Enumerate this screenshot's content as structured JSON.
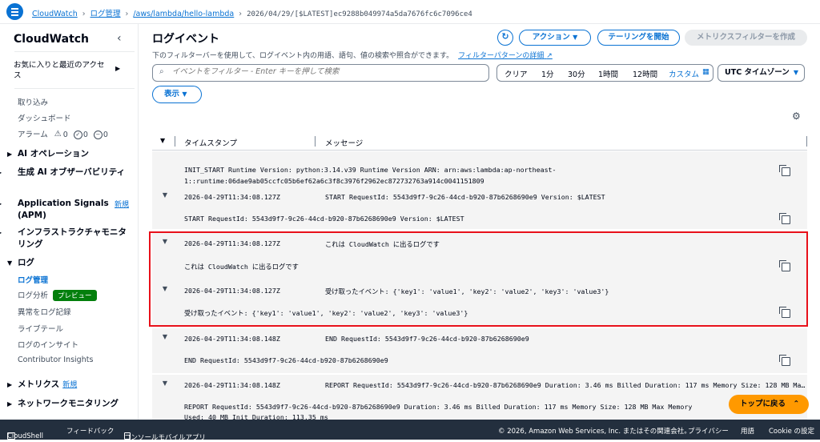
{
  "breadcrumb": {
    "items": [
      "CloudWatch",
      "ログ管理",
      "/aws/lambda/hello-lambda"
    ],
    "current": "2026/04/29/[$LATEST]ec9288b049974a5da7676fc6c7096ce4"
  },
  "sidebar": {
    "title": "CloudWatch",
    "favorites": "お気に入りと最近のアクセス",
    "items_top": [
      "取り込み",
      "ダッシュボード"
    ],
    "alarms": {
      "label": "アラーム",
      "counts": [
        "0",
        "0",
        "0"
      ]
    },
    "sections": [
      {
        "label": "AI オペレーション"
      },
      {
        "label": "生成 AI オブザーバビリティ"
      },
      {
        "label": "Application Signals (APM)",
        "badge": "新規"
      },
      {
        "label": "インフラストラクチャモニタリング"
      },
      {
        "label": "ログ"
      }
    ],
    "log_items": [
      "ログ管理",
      "ログ分析",
      "異常をログ記録",
      "ライブテール",
      "ログのインサイト",
      "Contributor Insights"
    ],
    "preview_badge": "プレビュー",
    "sections_bottom": [
      {
        "label": "メトリクス",
        "badge": "新規"
      },
      {
        "label": "ネットワークモニタリング"
      }
    ]
  },
  "main": {
    "title": "ログイベント",
    "description": "下のフィルターバーを使用して、ログイベント内の用語、語句、値の検索や照合ができます。",
    "filter_link": "フィルターパターンの詳細",
    "buttons": {
      "action": "アクション",
      "tailing": "テーリングを開始",
      "metric_filter": "メトリクスフィルターを作成"
    },
    "search_placeholder": "イベントをフィルター - Enter キーを押して検索",
    "time_ranges": [
      "クリア",
      "1分",
      "30分",
      "1時間",
      "12時間",
      "カスタム"
    ],
    "timezone": "UTC タイムゾーン",
    "display": "表示",
    "columns": {
      "timestamp": "タイムスタンプ",
      "message": "メッセージ"
    }
  },
  "events": [
    {
      "detail": "INIT_START Runtime Version: python:3.14.v39     Runtime Version ARN: arn:aws:lambda:ap-northeast-",
      "detail2": "1::runtime:06dae9ab05ccfc05b6ef62a6c3f8c3976f2962ec872732763a914c0041151809"
    },
    {
      "timestamp": "2026-04-29T11:34:08.127Z",
      "message": "START RequestId: 5543d9f7-9c26-44cd-b920-87b6268690e9 Version: $LATEST",
      "detail": "START RequestId: 5543d9f7-9c26-44cd-b920-87b6268690e9 Version: $LATEST"
    },
    {
      "timestamp": "2026-04-29T11:34:08.127Z",
      "message": "これは CloudWatch に出るログです",
      "detail": "これは CloudWatch に出るログです"
    },
    {
      "timestamp": "2026-04-29T11:34:08.127Z",
      "message": "受け取ったイベント: {'key1': 'value1', 'key2': 'value2', 'key3': 'value3'}",
      "detail": "受け取ったイベント: {'key1': 'value1', 'key2': 'value2', 'key3': 'value3'}"
    },
    {
      "timestamp": "2026-04-29T11:34:08.148Z",
      "message": "END RequestId: 5543d9f7-9c26-44cd-b920-87b6268690e9",
      "detail": "END RequestId: 5543d9f7-9c26-44cd-b920-87b6268690e9"
    },
    {
      "timestamp": "2026-04-29T11:34:08.148Z",
      "message": "REPORT RequestId: 5543d9f7-9c26-44cd-b920-87b6268690e9 Duration: 3.46 ms Billed Duration: 117 ms Memory Size: 128 MB Ma…",
      "detail": "REPORT RequestId: 5543d9f7-9c26-44cd-b920-87b6268690e9  Duration: 3.46 ms       Billed Duration: 117 ms Memory Size: 128 MB     Max Memory",
      "detail2": "Used: 40 MB        Init Duration: 113.35 ms"
    }
  ],
  "back_to_top": "トップに戻る",
  "footer": {
    "cloudshell": "CloudShell",
    "feedback": "フィードバック",
    "console_mobile": "コンソールモバイルアプリ",
    "copyright": "© 2026, Amazon Web Services, Inc. またはその関連会社。",
    "privacy": "プライバシー",
    "terms": "用語",
    "cookie": "Cookie の設定"
  },
  "colors": {
    "accent": "#0972d3",
    "highlight": "#e8101a",
    "scroll_button": "#ff9900",
    "footer_bg": "#232f3e"
  }
}
